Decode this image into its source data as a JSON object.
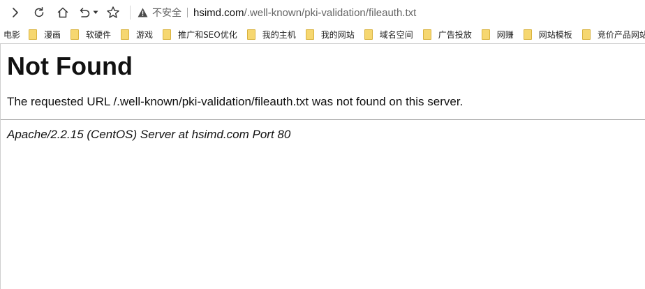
{
  "toolbar": {
    "security_label": "不安全",
    "url_host": "hsimd.com",
    "url_path": "/.well-known/pki-validation/fileauth.txt"
  },
  "bookmarks": [
    {
      "label": "电影"
    },
    {
      "label": "漫画"
    },
    {
      "label": "软硬件"
    },
    {
      "label": "游戏"
    },
    {
      "label": "推广和SEO优化"
    },
    {
      "label": "我的主机"
    },
    {
      "label": "我的网站"
    },
    {
      "label": "域名空间"
    },
    {
      "label": "广告投放"
    },
    {
      "label": "网赚"
    },
    {
      "label": "网站模板"
    },
    {
      "label": "竞价产品网站"
    }
  ],
  "page": {
    "heading": "Not Found",
    "message": "The requested URL /.well-known/pki-validation/fileauth.txt was not found on this server.",
    "server_signature": "Apache/2.2.15 (CentOS) Server at hsimd.com Port 80"
  }
}
